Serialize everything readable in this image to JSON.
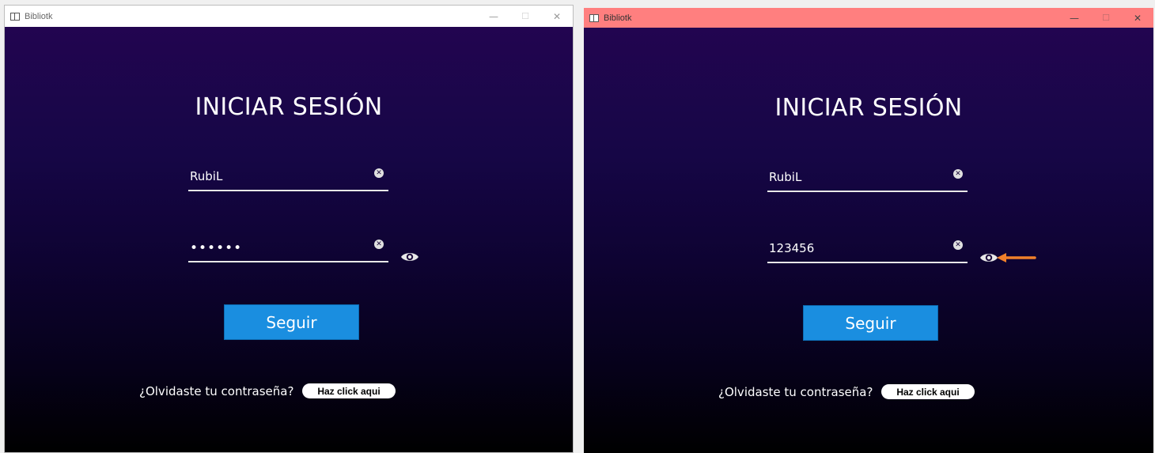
{
  "windows": [
    {
      "title": "Bibliotk",
      "titlebar_color": "#ffffff",
      "controls": {
        "minimize": "—",
        "maximize": "☐",
        "close": "✕"
      },
      "heading": "INICIAR SESIÓN",
      "username": {
        "value": "RubiL",
        "clear_icon": "clear-icon"
      },
      "password": {
        "value": "••••••",
        "masked": true,
        "clear_icon": "clear-icon"
      },
      "show_password_icon": "eye-icon",
      "submit_label": "Seguir",
      "forgot_text": "¿Olvidaste tu contraseña?",
      "forgot_link": "Haz click aqui",
      "accent_color": "#1a8ee0"
    },
    {
      "title": "Bibliotk",
      "titlebar_color": "#ff7f7f",
      "controls": {
        "minimize": "—",
        "maximize": "☐",
        "close": "✕"
      },
      "heading": "INICIAR SESIÓN",
      "username": {
        "value": "RubiL",
        "clear_icon": "clear-icon"
      },
      "password": {
        "value": "123456",
        "masked": false,
        "clear_icon": "clear-icon"
      },
      "show_password_icon": "eye-icon",
      "annotation_icon": "arrow-left-icon",
      "annotation_color": "#f0802a",
      "submit_label": "Seguir",
      "forgot_text": "¿Olvidaste tu contraseña?",
      "forgot_link": "Haz click aqui",
      "accent_color": "#1a8ee0"
    }
  ]
}
